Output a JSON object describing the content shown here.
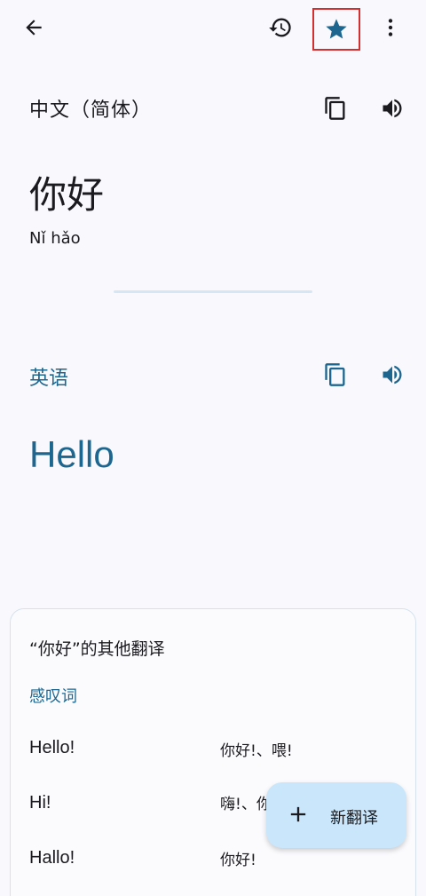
{
  "toolbar": {
    "back_icon": "arrow-back-icon",
    "history_icon": "history-icon",
    "star_icon": "star-icon",
    "more_icon": "more-vert-icon"
  },
  "source": {
    "language": "中文（简体）",
    "text": "你好",
    "transliteration": "Nǐ hǎo"
  },
  "target": {
    "language": "英语",
    "text": "Hello"
  },
  "other_translations": {
    "title": "“你好”的其他翻译",
    "part_of_speech": "感叹词",
    "rows": [
      {
        "english": "Hello!",
        "chinese": "你好!、喂!"
      },
      {
        "english": "Hi!",
        "chinese": "嗨!、你"
      },
      {
        "english": "Hallo!",
        "chinese": "你好!"
      }
    ]
  },
  "fab": {
    "label": "新翻译"
  },
  "colors": {
    "accent": "#1c6690",
    "background": "#f9f9fd",
    "fab_bg": "#c9e6fb",
    "highlight_border": "#d32f2f"
  }
}
